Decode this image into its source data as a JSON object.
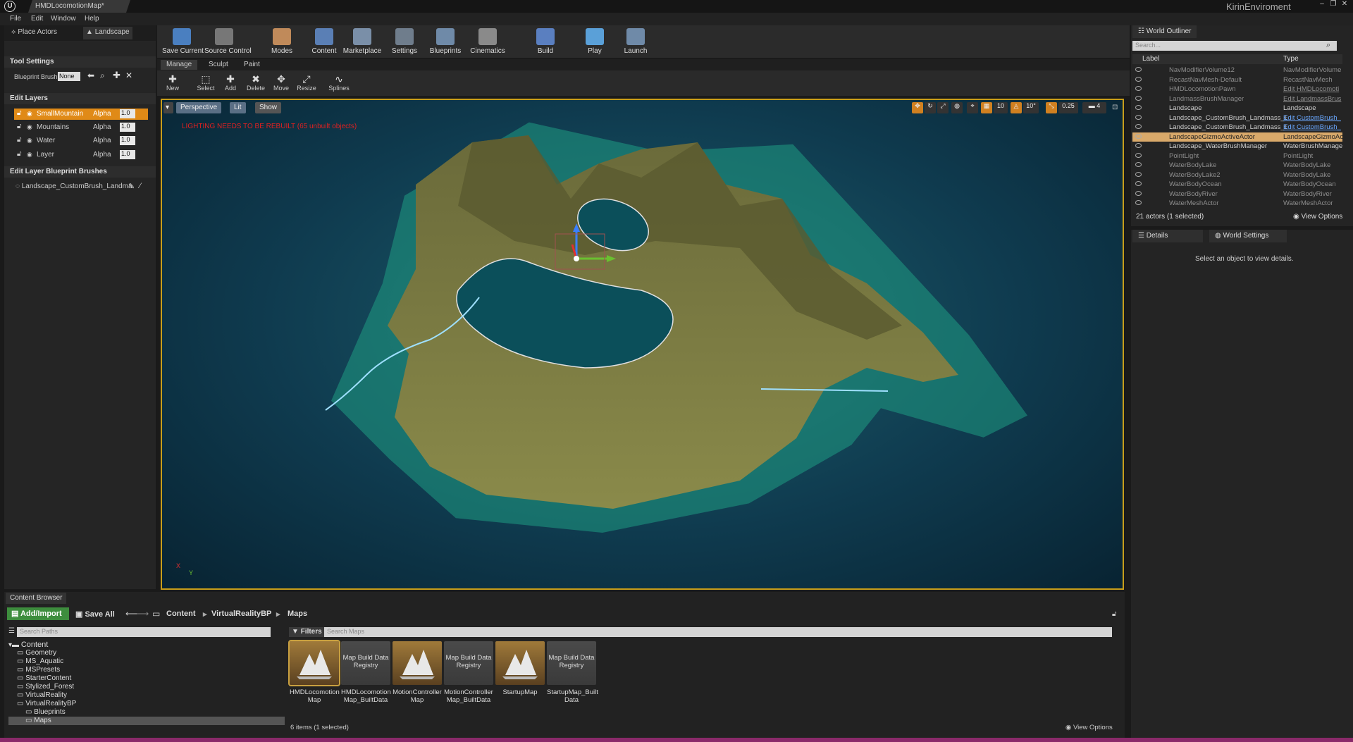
{
  "window": {
    "tab_title": "HMDLocomotionMap*",
    "project": "KirinEnviroment"
  },
  "menu": [
    "File",
    "Edit",
    "Window",
    "Help"
  ],
  "mode_tabs": {
    "place": "Place Actors",
    "landscape": "Landscape"
  },
  "tool_settings": {
    "header": "Tool Settings",
    "blueprint_brush_label": "Blueprint Brush",
    "blueprint_brush_value": "None"
  },
  "edit_layers": {
    "header": "Edit Layers",
    "layers": [
      {
        "name": "SmallMountain",
        "alpha_label": "Alpha",
        "value": "1.0",
        "selected": true
      },
      {
        "name": "Mountains",
        "alpha_label": "Alpha",
        "value": "1.0"
      },
      {
        "name": "Water",
        "alpha_label": "Alpha",
        "value": "1.0"
      },
      {
        "name": "Layer",
        "alpha_label": "Alpha",
        "value": "1.0"
      }
    ]
  },
  "edit_brushes": {
    "header": "Edit Layer Blueprint Brushes",
    "item": "Landscape_CustomBrush_Landma"
  },
  "toolbar": [
    {
      "label": "Save Current",
      "icon": "save-icon",
      "color": "#4a7fc0"
    },
    {
      "label": "Source Control",
      "icon": "source-control-icon",
      "color": "#777777"
    },
    {
      "label": "Modes",
      "icon": "modes-icon",
      "color": "#c08a5a"
    },
    {
      "label": "Content",
      "icon": "content-icon",
      "color": "#5a7fb5"
    },
    {
      "label": "Marketplace",
      "icon": "marketplace-icon",
      "color": "#7a8fa8"
    },
    {
      "label": "Settings",
      "icon": "settings-icon",
      "color": "#6f7d8c"
    },
    {
      "label": "Blueprints",
      "icon": "blueprints-icon",
      "color": "#6f8aa8"
    },
    {
      "label": "Cinematics",
      "icon": "cinematics-icon",
      "color": "#8a8a8a"
    },
    {
      "label": "Build",
      "icon": "build-icon",
      "color": "#5a7fc0"
    },
    {
      "label": "Play",
      "icon": "play-icon",
      "color": "#5aa0d8"
    },
    {
      "label": "Launch",
      "icon": "launch-icon",
      "color": "#6f8aa8"
    }
  ],
  "sub_tabs": [
    "Manage",
    "Sculpt",
    "Paint"
  ],
  "sub_tools": [
    {
      "label": "New",
      "glyph": "✚"
    },
    {
      "label": "Select",
      "glyph": "⬚"
    },
    {
      "label": "Add",
      "glyph": "✚"
    },
    {
      "label": "Delete",
      "glyph": "✖"
    },
    {
      "label": "Move",
      "glyph": "✥"
    },
    {
      "label": "Resize",
      "glyph": "⤢"
    },
    {
      "label": "Splines",
      "glyph": "∿"
    }
  ],
  "viewport": {
    "perspective": "Perspective",
    "lit": "Lit",
    "show": "Show",
    "warning": "LIGHTING NEEDS TO BE REBUILT (65 unbuilt objects)",
    "grid_snap": "10",
    "rot_snap": "10°",
    "scale_snap": "0.25",
    "cam_speed": "4",
    "axis_x": "X",
    "axis_y": "Y"
  },
  "outliner": {
    "tab": "World Outliner",
    "search_placeholder": "Search...",
    "col_label": "Label",
    "col_type": "Type",
    "rows": [
      {
        "label": "NavModifierVolume12",
        "type": "NavModifierVolume",
        "dim": true
      },
      {
        "label": "RecastNavMesh-Default",
        "type": "RecastNavMesh",
        "dim": true
      },
      {
        "label": "HMDLocomotionPawn",
        "type": "Edit HMDLocomoti",
        "dim": true,
        "link": true
      },
      {
        "label": "LandmassBrushManager",
        "type": "Edit LandmassBrus",
        "dim": true,
        "link": true
      },
      {
        "label": "Landscape",
        "type": "Landscape"
      },
      {
        "label": "Landscape_CustomBrush_Landmass_C",
        "type": "Edit CustomBrush_",
        "link": true
      },
      {
        "label": "Landscape_CustomBrush_Landmass_C",
        "type": "Edit CustomBrush_",
        "link": true
      },
      {
        "label": "LandscapeGizmoActiveActor",
        "type": "LandscapeGizmoAc",
        "selected": true
      },
      {
        "label": "Landscape_WaterBrushManager",
        "type": "WaterBrushManager"
      },
      {
        "label": "PointLight",
        "type": "PointLight",
        "dim": true
      },
      {
        "label": "WaterBodyLake",
        "type": "WaterBodyLake",
        "dim": true
      },
      {
        "label": "WaterBodyLake2",
        "type": "WaterBodyLake",
        "dim": true
      },
      {
        "label": "WaterBodyOcean",
        "type": "WaterBodyOcean",
        "dim": true
      },
      {
        "label": "WaterBodyRiver",
        "type": "WaterBodyRiver",
        "dim": true
      },
      {
        "label": "WaterMeshActor",
        "type": "WaterMeshActor",
        "dim": true
      }
    ],
    "count": "21 actors (1 selected)",
    "view_options": "View Options"
  },
  "details": {
    "tab": "Details",
    "tab2": "World Settings",
    "message": "Select an object to view details."
  },
  "content_browser": {
    "tab": "Content Browser",
    "add_import": "Add/Import",
    "save_all": "Save All",
    "breadcrumb": [
      "Content",
      "VirtualRealityBP",
      "Maps"
    ],
    "path_search": "Search Paths",
    "filters": "Filters",
    "map_search": "Search Maps",
    "tree": [
      {
        "label": "Content",
        "indent": 0,
        "root": true
      },
      {
        "label": "Geometry",
        "indent": 1
      },
      {
        "label": "MS_Aquatic",
        "indent": 1
      },
      {
        "label": "MSPresets",
        "indent": 1
      },
      {
        "label": "StarterContent",
        "indent": 1
      },
      {
        "label": "Stylized_Forest",
        "indent": 1
      },
      {
        "label": "VirtualReality",
        "indent": 1
      },
      {
        "label": "VirtualRealityBP",
        "indent": 1,
        "open": true
      },
      {
        "label": "Blueprints",
        "indent": 2
      },
      {
        "label": "Maps",
        "indent": 2,
        "selected": true
      }
    ],
    "assets": [
      {
        "name": "HMDLocomotion Map",
        "kind": "map",
        "selected": true
      },
      {
        "name": "HMDLocomotion Map_BuiltData",
        "kind": "reg",
        "thumb": "Map Build Data Registry"
      },
      {
        "name": "MotionController Map",
        "kind": "map"
      },
      {
        "name": "MotionController Map_BuiltData",
        "kind": "reg",
        "thumb": "Map Build Data Registry"
      },
      {
        "name": "StartupMap",
        "kind": "map"
      },
      {
        "name": "StartupMap_Built Data",
        "kind": "reg",
        "thumb": "Map Build Data Registry"
      }
    ],
    "count": "6 items (1 selected)",
    "view_options": "View Options"
  },
  "colors": {
    "accent": "#e08a17",
    "viewport_border": "#c89e1a",
    "selection": "#d9a96a",
    "link": "#6aa8ff"
  }
}
